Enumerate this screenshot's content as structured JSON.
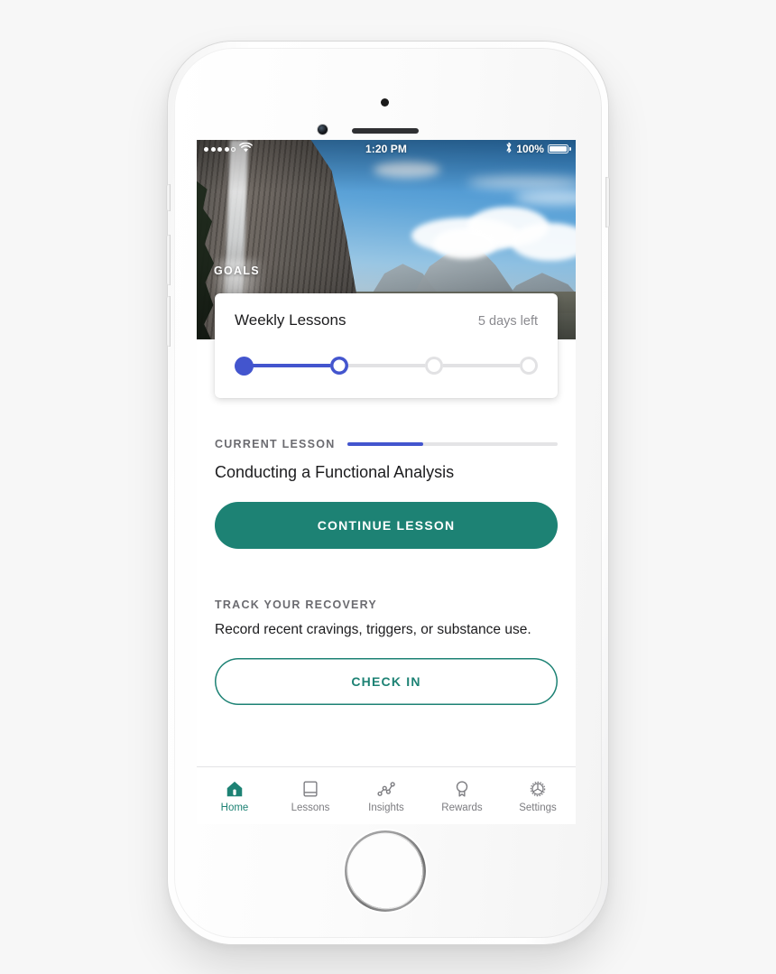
{
  "device": {
    "name": "iphone-white",
    "hardware": [
      "front-camera",
      "proximity-sensor",
      "earpiece-speaker",
      "home-button",
      "mute-switch",
      "volume-up",
      "volume-down",
      "power-button"
    ]
  },
  "status_bar": {
    "carrier_signal_filled": 4,
    "carrier_signal_total": 5,
    "wifi_icon": "wifi-icon",
    "time": "1:20 PM",
    "bluetooth_icon": "bluetooth-icon",
    "battery_percent": "100%",
    "battery_icon": "battery-full-icon"
  },
  "hero": {
    "photo_description": "yosemite-waterfall-half-dome",
    "section_label": "GOALS"
  },
  "goals_card": {
    "title": "Weekly Lessons",
    "subtitle": "5 days left",
    "steps_total": 4,
    "steps_completed": 1,
    "step_states": [
      "done",
      "current",
      "todo",
      "todo"
    ],
    "accent_color": "#4355ce",
    "track_color": "#e2e2e4"
  },
  "current_lesson": {
    "kicker": "CURRENT LESSON",
    "progress_percent": 36,
    "title": "Conducting a Functional Analysis",
    "button_label": "CONTINUE LESSON",
    "button_color": "#1d8274"
  },
  "track_recovery": {
    "kicker": "TRACK YOUR RECOVERY",
    "description": "Record recent cravings, triggers, or substance use.",
    "button_label": "CHECK IN",
    "button_color": "#1d8274"
  },
  "tab_bar": {
    "active_index": 0,
    "active_color": "#1d8274",
    "inactive_color": "#7c7c80",
    "items": [
      {
        "label": "Home",
        "icon": "home-icon"
      },
      {
        "label": "Lessons",
        "icon": "book-icon"
      },
      {
        "label": "Insights",
        "icon": "line-chart-icon"
      },
      {
        "label": "Rewards",
        "icon": "award-medal-icon"
      },
      {
        "label": "Settings",
        "icon": "gear-icon"
      }
    ]
  }
}
